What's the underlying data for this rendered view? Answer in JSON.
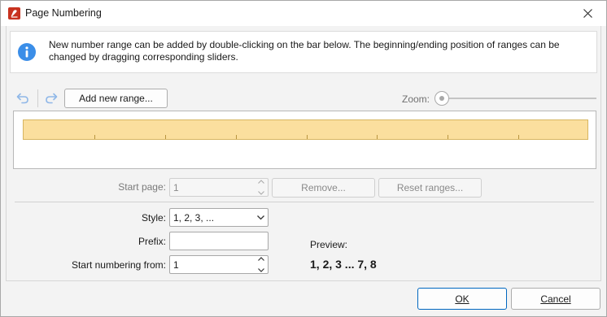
{
  "window": {
    "title": "Page Numbering"
  },
  "info": {
    "text": "New number range can be added by double-clicking on the bar below. The beginning/ending position of ranges can be changed by dragging corresponding sliders."
  },
  "toolbar": {
    "add_range_label": "Add new range...",
    "zoom_label": "Zoom:",
    "zoom_level": 0
  },
  "range": {
    "start_page_label": "Start page:",
    "start_page_value": "1",
    "remove_label": "Remove...",
    "reset_label": "Reset ranges..."
  },
  "format": {
    "style_label": "Style:",
    "style_value": "1, 2, 3, ...",
    "prefix_label": "Prefix:",
    "prefix_value": "",
    "start_from_label": "Start numbering from:",
    "start_from_value": "1",
    "preview_label": "Preview:",
    "preview_value": "1, 2, 3 ... 7, 8"
  },
  "footer": {
    "ok_label": "OK",
    "cancel_label": "Cancel"
  },
  "colors": {
    "range_fill": "#fbdf9e",
    "info_accent": "#3b8ee8",
    "app_icon": "#c8321f"
  }
}
